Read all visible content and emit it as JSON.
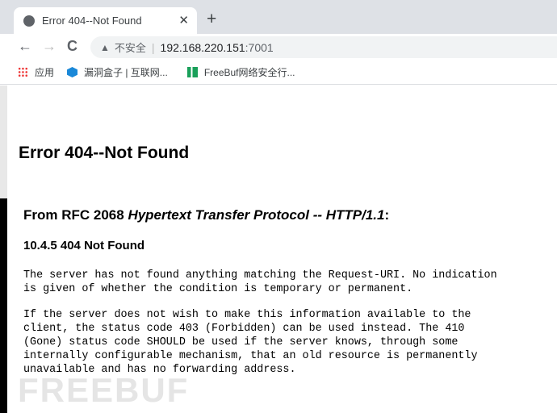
{
  "browser": {
    "tab": {
      "title": "Error 404--Not Found",
      "icon": "globe-icon"
    },
    "new_tab": "+",
    "close": "✕",
    "nav": {
      "back": "←",
      "forward": "→",
      "reload": "C"
    },
    "address": {
      "security_label": "不安全",
      "host": "192.168.220.151",
      "port": ":7001"
    },
    "bookmarks": [
      {
        "label": "应用",
        "icon": "apps-icon"
      },
      {
        "label": "漏洞盒子 | 互联网...",
        "icon": "hexagon-icon"
      },
      {
        "label": "FreeBuf网络安全行...",
        "icon": "freebuf-icon"
      }
    ]
  },
  "page": {
    "title": "Error 404--Not Found",
    "subtitle_prefix": "From RFC 2068 ",
    "subtitle_italic": "Hypertext Transfer Protocol -- HTTP/1.1",
    "subtitle_suffix": ":",
    "section": "10.4.5 404 Not Found",
    "para1": "The server has not found anything matching the Request-URI. No indication\nis given of whether the condition is temporary or permanent.",
    "para2": "If the server does not wish to make this information available to the\nclient, the status code 403 (Forbidden) can be used instead. The 410\n(Gone) status code SHOULD be used if the server knows, through some\ninternally configurable mechanism, that an old resource is permanently\nunavailable and has no forwarding address."
  },
  "watermark": "FREEBUF"
}
